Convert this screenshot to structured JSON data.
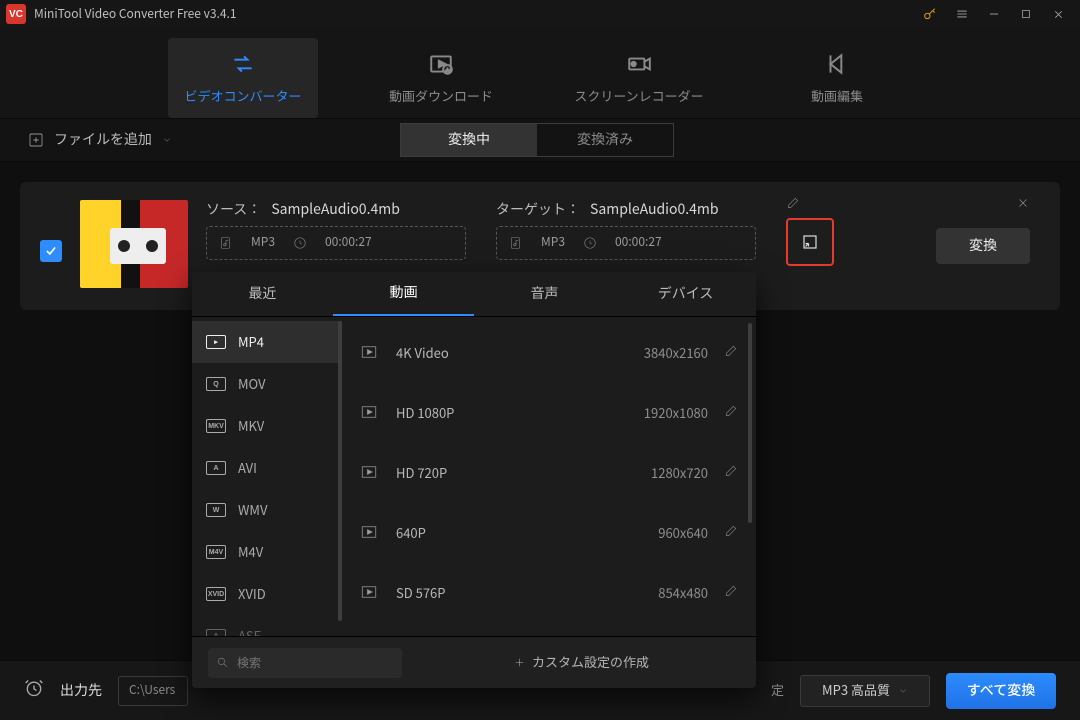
{
  "app": {
    "title": "MiniTool Video Converter Free v3.4.1"
  },
  "tabs": {
    "converter": "ビデオコンバーター",
    "download": "動画ダウンロード",
    "record": "スクリーンレコーダー",
    "edit": "動画編集"
  },
  "toolbar": {
    "add_files": "ファイルを追加",
    "converting": "変換中",
    "converted": "変換済み"
  },
  "job": {
    "source_label": "ソース：",
    "target_label": "ターゲット：",
    "source_name": "SampleAudio0.4mb",
    "target_name": "SampleAudio0.4mb",
    "source_codec": "MP3",
    "target_codec": "MP3",
    "source_dur": "00:00:27",
    "target_dur": "00:00:27",
    "convert_btn": "変換"
  },
  "popup": {
    "tabs": {
      "recent": "最近",
      "video": "動画",
      "audio": "音声",
      "device": "デバイス"
    },
    "formats": [
      "MP4",
      "MOV",
      "MKV",
      "AVI",
      "WMV",
      "M4V",
      "XVID",
      "ASF"
    ],
    "presets": [
      {
        "label": "4K Video",
        "res": "3840x2160"
      },
      {
        "label": "HD 1080P",
        "res": "1920x1080"
      },
      {
        "label": "HD 720P",
        "res": "1280x720"
      },
      {
        "label": "640P",
        "res": "960x640"
      },
      {
        "label": "SD 576P",
        "res": "854x480"
      }
    ],
    "search_placeholder": "検索",
    "new_preset": "カスタム設定の作成"
  },
  "bottom": {
    "output_label": "出力先",
    "output_path": "C:\\Users",
    "preset": "MP3 高品質",
    "convert_all": "すべて変換",
    "trailing": "定"
  }
}
